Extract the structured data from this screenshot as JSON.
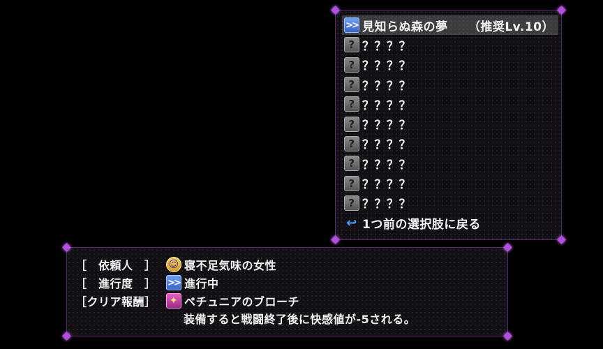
{
  "quest_list": {
    "selected": {
      "title": "見知らぬ森の夢",
      "level": "（推奨Lv.10）",
      "icon": "forward-arrow-icon"
    },
    "unknown_items": [
      "？？？？",
      "？？？？",
      "？？？？",
      "？？？？",
      "？？？？",
      "？？？？",
      "？？？？",
      "？？？？",
      "？？？？"
    ],
    "back_label": "1つ前の選択肢に戻る"
  },
  "details": {
    "client_label": "［　依頼人　］",
    "client_value": "寝不足気味の女性",
    "progress_label": "［　進行度　］",
    "progress_value": "進行中",
    "reward_label": "［クリア報酬］",
    "reward_value": "ペチュニアのブローチ",
    "reward_description": "装備すると戦闘終了後に快感値が-5される。"
  },
  "colors": {
    "accent": "#b24ee0",
    "window_bg": "#121014",
    "selected_icon": "#4a78d8",
    "text": "#f2f2f2"
  }
}
